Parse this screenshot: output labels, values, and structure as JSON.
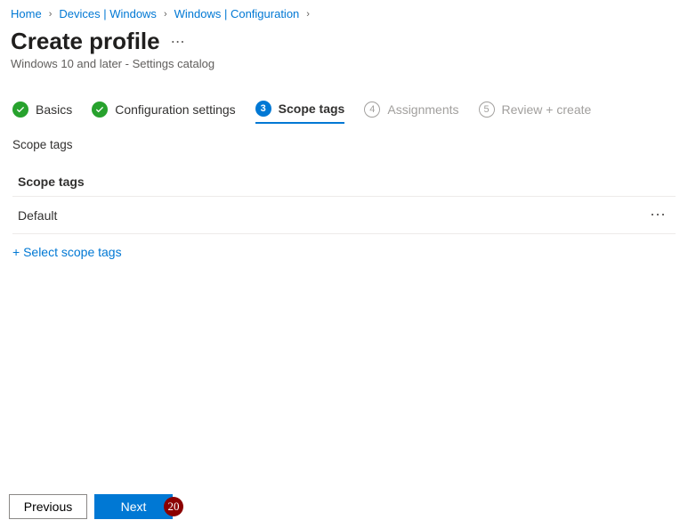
{
  "breadcrumb": {
    "items": [
      "Home",
      "Devices | Windows",
      "Windows | Configuration"
    ]
  },
  "header": {
    "title": "Create profile",
    "subtitle": "Windows 10 and later - Settings catalog"
  },
  "wizard": {
    "steps": [
      {
        "label": "Basics",
        "state": "complete"
      },
      {
        "label": "Configuration settings",
        "state": "complete"
      },
      {
        "label": "Scope tags",
        "state": "current",
        "num": "3"
      },
      {
        "label": "Assignments",
        "state": "upcoming",
        "num": "4"
      },
      {
        "label": "Review + create",
        "state": "upcoming",
        "num": "5"
      }
    ]
  },
  "section": {
    "summary_label": "Scope tags",
    "card_header": "Scope tags",
    "rows": [
      {
        "value": "Default"
      }
    ],
    "add_link_label": "+ Select scope tags"
  },
  "footer": {
    "previous_label": "Previous",
    "next_label": "Next"
  },
  "annotation": {
    "badge": "20"
  }
}
